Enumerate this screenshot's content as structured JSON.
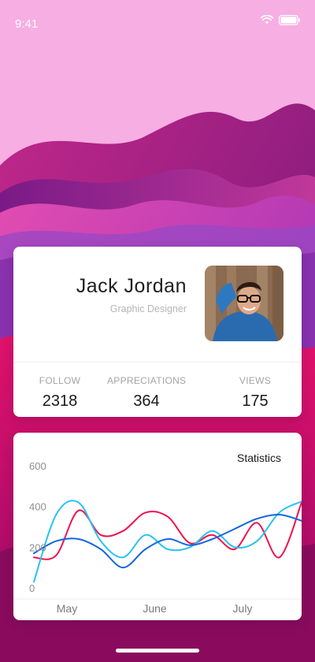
{
  "status_bar": {
    "time": "9:41"
  },
  "profile": {
    "name": "Jack Jordan",
    "role": "Graphic Designer",
    "stats": [
      {
        "label": "FOLLOW",
        "value": "2318"
      },
      {
        "label": "APPRECIATIONS",
        "value": "364"
      },
      {
        "label": "VIEWS",
        "value": "175"
      }
    ]
  },
  "chart_data": {
    "type": "line",
    "title": "Statistics",
    "xlabel": "",
    "ylabel": "",
    "categories": [
      "May",
      "June",
      "July"
    ],
    "y_ticks": [
      "600",
      "400",
      "200",
      "0"
    ],
    "ylim": [
      0,
      600
    ],
    "grid": false,
    "x": [
      0,
      0.5,
      1,
      1.5,
      2,
      2.5,
      3,
      3.5,
      4,
      4.5,
      5,
      5.5,
      6
    ],
    "series": [
      {
        "color": "#f0124e",
        "values": [
          150,
          160,
          380,
          260,
          280,
          370,
          350,
          220,
          260,
          190,
          320,
          150,
          420
        ]
      },
      {
        "color": "#29c3ef",
        "values": [
          30,
          360,
          420,
          230,
          150,
          260,
          190,
          200,
          280,
          200,
          230,
          370,
          425
        ]
      },
      {
        "color": "#1266e0",
        "values": [
          170,
          230,
          240,
          190,
          100,
          190,
          240,
          210,
          240,
          290,
          340,
          360,
          330
        ]
      }
    ]
  }
}
